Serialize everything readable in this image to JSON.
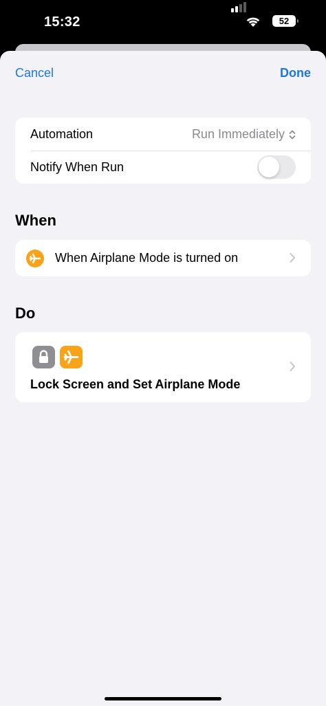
{
  "status_bar": {
    "time": "15:32",
    "battery": "52"
  },
  "nav": {
    "cancel_label": "Cancel",
    "done_label": "Done"
  },
  "settings": {
    "automation_label": "Automation",
    "automation_value": "Run Immediately",
    "notify_label": "Notify When Run",
    "notify_enabled": false
  },
  "when": {
    "title": "When",
    "trigger_label": "When Airplane Mode is turned on",
    "trigger_icon": "airplane-icon"
  },
  "do": {
    "title": "Do",
    "action_label": "Lock Screen and Set Airplane Mode",
    "icons": [
      "lock-icon",
      "airplane-icon"
    ]
  },
  "colors": {
    "accent": "#1e78d6",
    "orange": "#f8a31a",
    "gray_icon": "#8e8e93",
    "background": "#f2f2f7"
  }
}
